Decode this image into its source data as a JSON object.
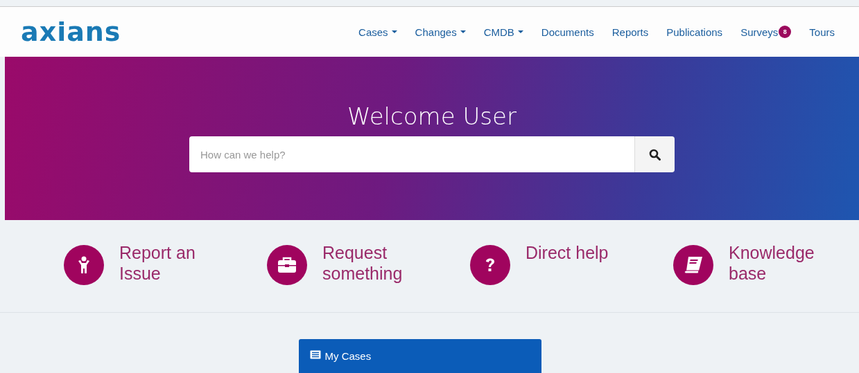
{
  "logo": {
    "text": "axians"
  },
  "nav": [
    {
      "label": "Cases",
      "kind": "dropdown"
    },
    {
      "label": "Changes",
      "kind": "dropdown"
    },
    {
      "label": "CMDB",
      "kind": "dropdown"
    },
    {
      "label": "Documents",
      "kind": "link"
    },
    {
      "label": "Reports",
      "kind": "link"
    },
    {
      "label": "Publications",
      "kind": "link"
    },
    {
      "label": "Surveys",
      "kind": "link",
      "badge": "8"
    },
    {
      "label": "Tours",
      "kind": "link"
    }
  ],
  "hero": {
    "title": "Welcome User",
    "search": {
      "placeholder": "How can we help?"
    }
  },
  "actions": [
    {
      "label": "Report an Issue"
    },
    {
      "label": "Request something"
    },
    {
      "label": "Direct help"
    },
    {
      "label": "Knowledge base"
    }
  ],
  "panel": {
    "title": "My Cases"
  }
}
